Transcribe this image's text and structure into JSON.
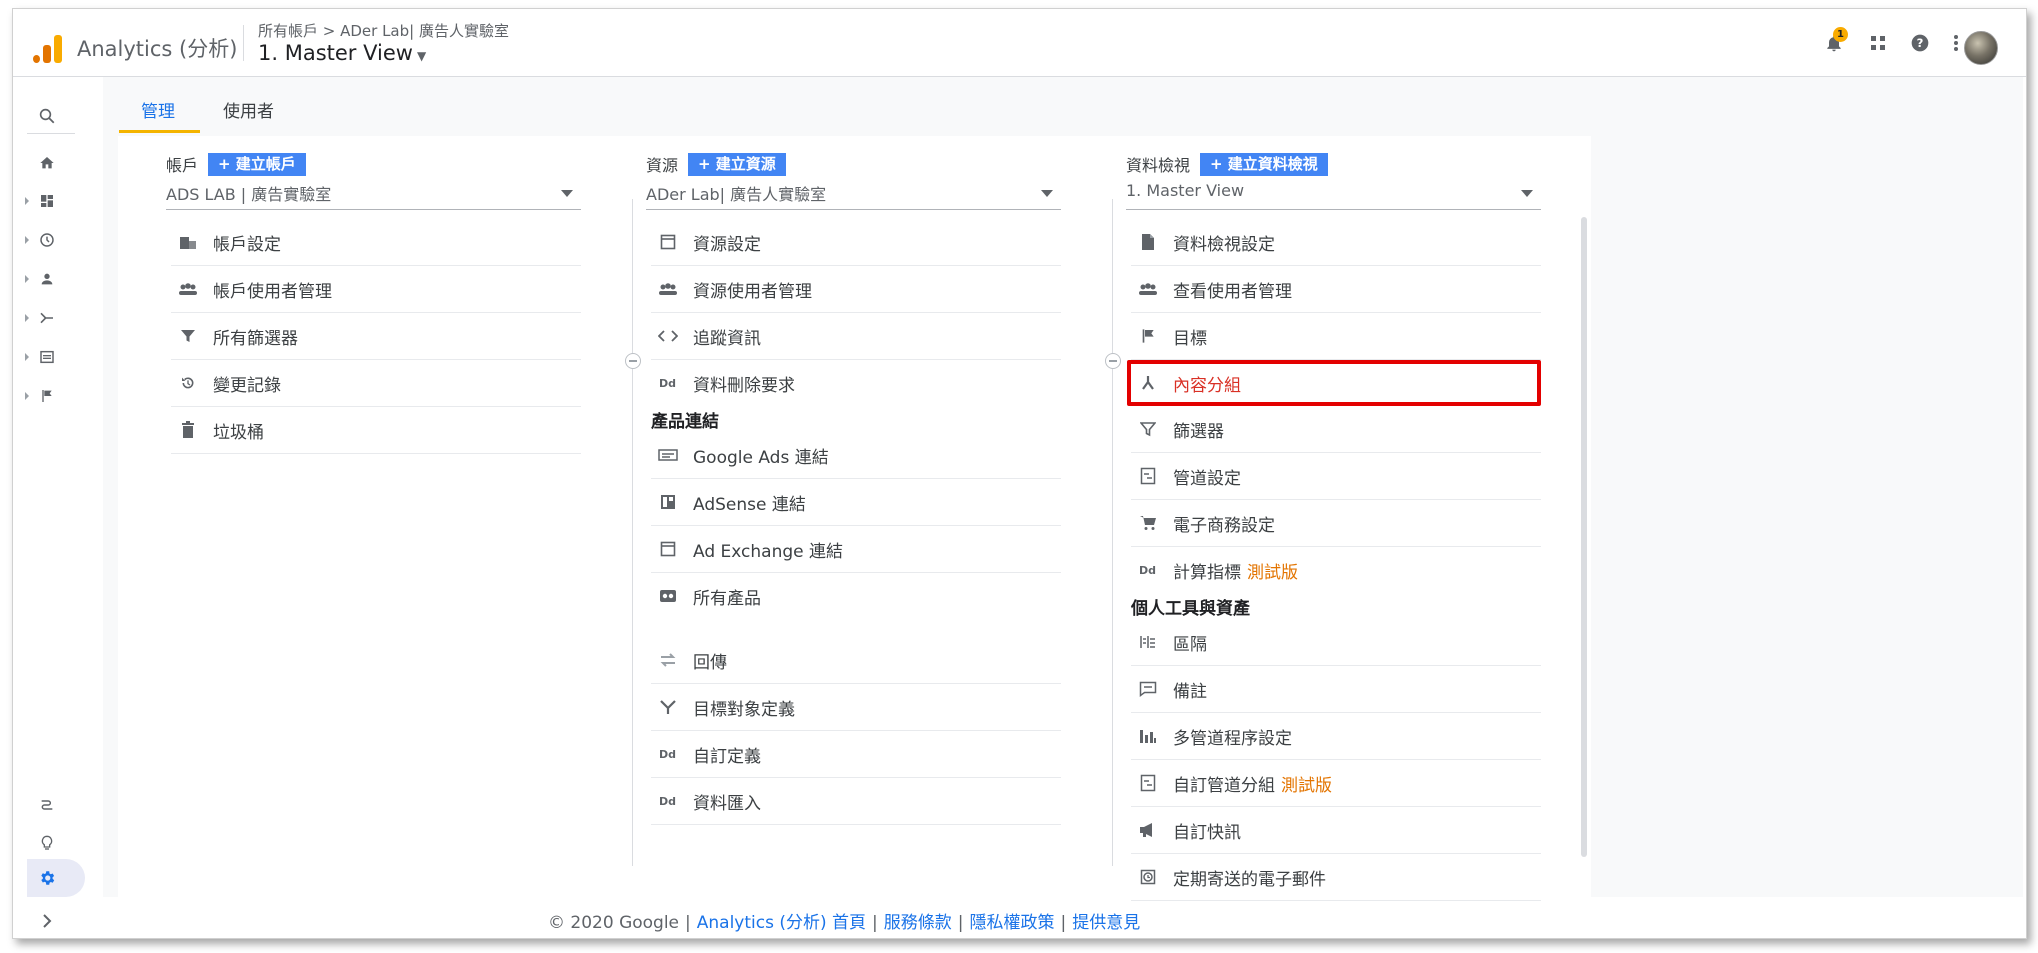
{
  "header": {
    "app_title": "Analytics (分析)",
    "breadcrumb": "所有帳戶 > ADer Lab| 廣告人實驗室",
    "view_name": "1. Master View",
    "notification_count": "1"
  },
  "tabs": [
    {
      "label": "管理"
    },
    {
      "label": "使用者"
    }
  ],
  "columns": {
    "account": {
      "title": "帳戶",
      "create_label": "+ 建立帳戶",
      "selected": "ADS LAB | 廣告實驗室",
      "items": [
        {
          "label": "帳戶設定",
          "icon": "building-icon"
        },
        {
          "label": "帳戶使用者管理",
          "icon": "people-icon"
        },
        {
          "label": "所有篩選器",
          "icon": "filter-icon"
        },
        {
          "label": "變更記錄",
          "icon": "history-icon"
        },
        {
          "label": "垃圾桶",
          "icon": "trash-icon"
        }
      ]
    },
    "property": {
      "title": "資源",
      "create_label": "+ 建立資源",
      "selected": "ADer Lab| 廣告人實驗室",
      "items": [
        {
          "label": "資源設定",
          "icon": "window-icon"
        },
        {
          "label": "資源使用者管理",
          "icon": "people-icon"
        },
        {
          "label": "追蹤資訊",
          "icon": "code-icon"
        },
        {
          "label": "資料刪除要求",
          "icon": "dd-icon"
        }
      ],
      "section_product_links": "產品連結",
      "product_links": [
        {
          "label": "Google Ads 連結",
          "icon": "ads-icon"
        },
        {
          "label": "AdSense 連結",
          "icon": "adsense-icon"
        },
        {
          "label": "Ad Exchange 連結",
          "icon": "window-icon"
        },
        {
          "label": "所有產品",
          "icon": "products-icon"
        }
      ],
      "other_items": [
        {
          "label": "回傳",
          "icon": "postback-icon"
        },
        {
          "label": "目標對象定義",
          "icon": "audience-icon"
        },
        {
          "label": "自訂定義",
          "icon": "dd-icon"
        },
        {
          "label": "資料匯入",
          "icon": "dd-icon"
        }
      ]
    },
    "view": {
      "title": "資料檢視",
      "create_label": "+ 建立資料檢視",
      "selected": "1. Master View",
      "items": [
        {
          "label": "資料檢視設定",
          "icon": "document-icon",
          "beta": ""
        },
        {
          "label": "查看使用者管理",
          "icon": "people-icon",
          "beta": ""
        },
        {
          "label": "目標",
          "icon": "flag-icon",
          "beta": ""
        },
        {
          "label": "內容分組",
          "icon": "content-grouping-icon",
          "beta": ""
        },
        {
          "label": "篩選器",
          "icon": "filter-icon",
          "beta": ""
        },
        {
          "label": "管道設定",
          "icon": "channel-icon",
          "beta": ""
        },
        {
          "label": "電子商務設定",
          "icon": "cart-icon",
          "beta": ""
        },
        {
          "label": "計算指標",
          "icon": "dd-icon",
          "beta": "測試版"
        }
      ],
      "section_personal": "個人工具與資產",
      "personal_items": [
        {
          "label": "區隔",
          "icon": "segments-icon",
          "beta": ""
        },
        {
          "label": "備註",
          "icon": "annotation-icon",
          "beta": ""
        },
        {
          "label": "多管道程序設定",
          "icon": "bar-chart-icon",
          "beta": ""
        },
        {
          "label": "自訂管道分組",
          "icon": "channel-icon",
          "beta": "測試版"
        },
        {
          "label": "自訂快訊",
          "icon": "megaphone-icon",
          "beta": ""
        },
        {
          "label": "定期寄送的電子郵件",
          "icon": "clock-icon",
          "beta": ""
        }
      ]
    }
  },
  "footer": {
    "copyright": "© 2020 Google",
    "links": [
      "Analytics (分析) 首頁",
      "服務條款",
      "隱私權政策",
      "提供意見"
    ]
  },
  "colors": {
    "accent_blue": "#1a73e8",
    "create_button": "#4285f4",
    "tab_underline": "#f4b400",
    "highlight_box": "#e30000",
    "beta_orange": "#e37400"
  }
}
